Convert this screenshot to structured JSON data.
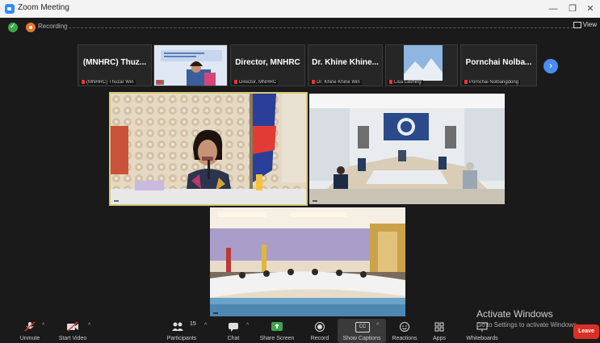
{
  "window": {
    "title": "Zoom Meeting",
    "minimize": "—",
    "maximize": "❐",
    "close": "✕"
  },
  "status": {
    "recording_label": "Recording",
    "view_label": "View"
  },
  "strip": [
    {
      "name": "(MNHRC) Thuz...",
      "label": "(MNHRC) Thuzar Win"
    },
    {
      "name": "",
      "label": ""
    },
    {
      "name": "Director, MNHRC",
      "label": "Director, MNHRC"
    },
    {
      "name": "Dr. Khine Khine...",
      "label": "Dr. Khine Khine Win"
    },
    {
      "name": "",
      "label": "Lisa Lashing"
    },
    {
      "name": "Pornchai Nolba...",
      "label": "Pornchai Nolbangdong"
    }
  ],
  "tiles": {
    "t1": "",
    "t2": "",
    "t3": ""
  },
  "toolbar": [
    {
      "label": "Unmute"
    },
    {
      "label": "Start Video"
    },
    {
      "label": "Participants",
      "count": "15"
    },
    {
      "label": "Chat"
    },
    {
      "label": "Share Screen"
    },
    {
      "label": "Record"
    },
    {
      "label": "Show Captions",
      "badge": "CC"
    },
    {
      "label": "Reactions"
    },
    {
      "label": "Apps"
    },
    {
      "label": "Whiteboards"
    }
  ],
  "watermark": {
    "line1": "Activate Windows",
    "line2": "Go to Settings to activate Windows."
  },
  "leave": "Leave",
  "colors": {
    "accent": "#2d8cff",
    "leave": "#d93025",
    "share": "#3ea64b",
    "active_tile_border": "#d9c77a"
  }
}
